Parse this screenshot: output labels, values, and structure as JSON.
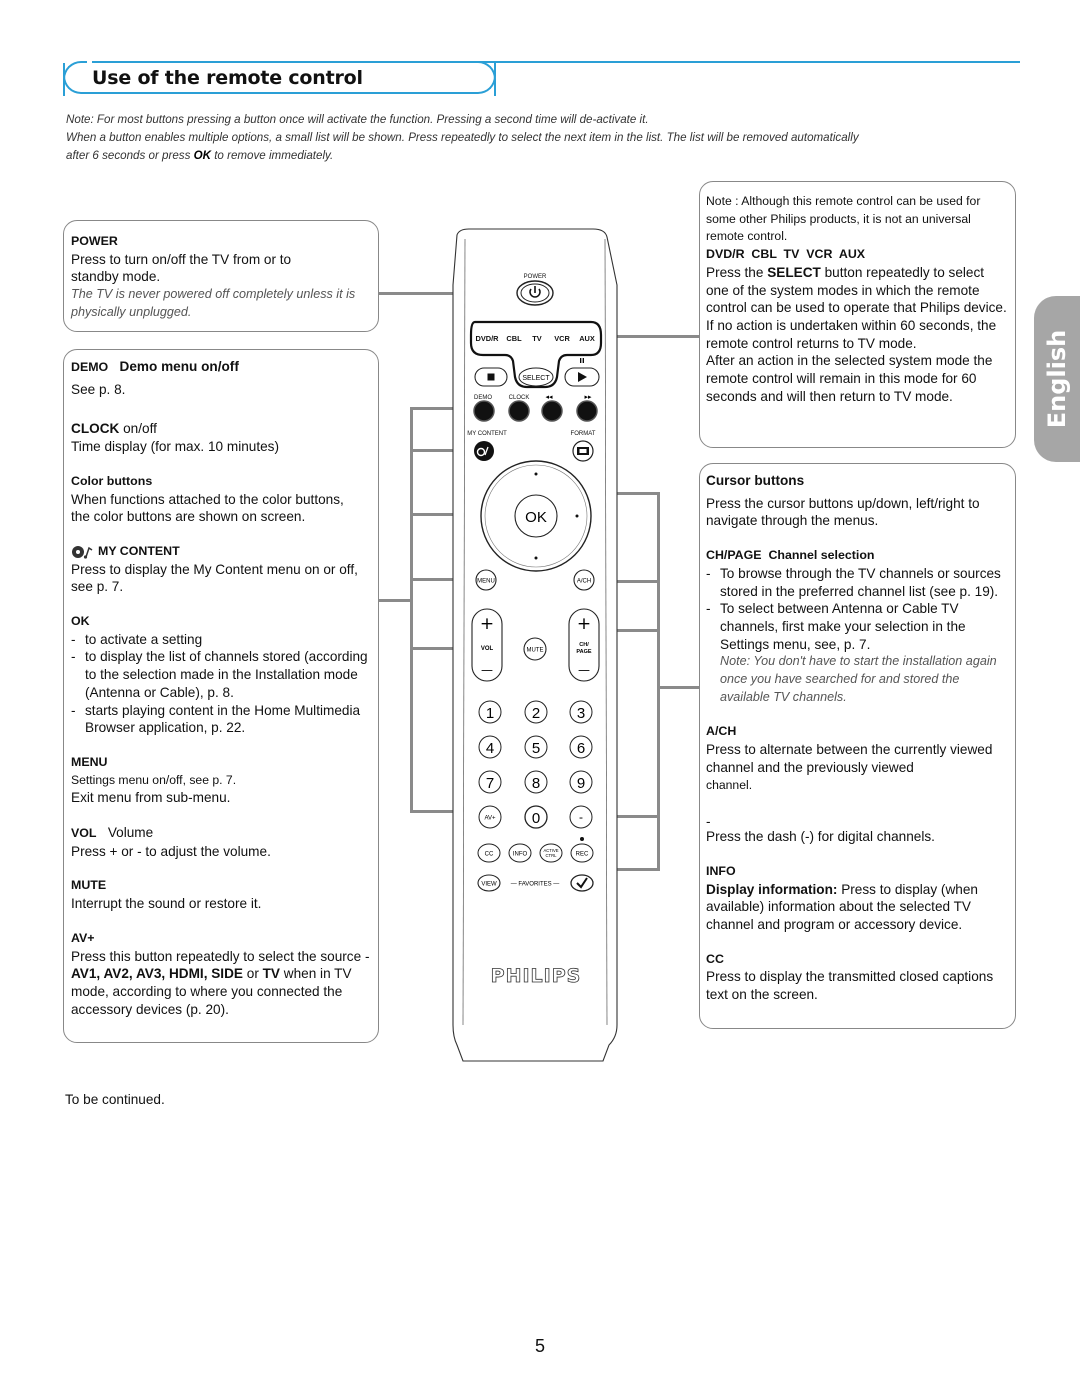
{
  "header": {
    "title": "Use of the remote control",
    "accent_color": "#2a9fd6"
  },
  "intro": {
    "line1": "Note: For most buttons pressing a button once will activate the function. Pressing a second time will de-activate it.",
    "line2": "When a button enables multiple options, a small list will be shown. Press repeatedly to select the next item in the list. The list will be removed automatically",
    "line3_before": "after 6 seconds or press ",
    "line3_bold": "OK",
    "line3_after": " to remove immediately."
  },
  "language_tab": {
    "label": "English",
    "color": "#a6a6a6"
  },
  "left": {
    "power": {
      "heading": "POWER",
      "text": "Press to turn on/off the TV from or to standby mode.",
      "note": "The TV is never powered off completely unless it is physically unplugged."
    },
    "demo": {
      "heading": "DEMO",
      "heading_desc": "Demo menu on/off",
      "text": "See p. 8."
    },
    "clock": {
      "heading": "CLOCK",
      "heading_desc": "on/off",
      "text": "Time display (for max. 10 minutes)"
    },
    "color_buttons": {
      "heading": "Color buttons",
      "text": "When functions attached to the color buttons, the color buttons are shown on screen."
    },
    "my_content": {
      "icon": "my-content-icon",
      "heading": "MY CONTENT",
      "text": "Press to display the My Content menu on or off, see p. 7."
    },
    "ok": {
      "heading": "OK",
      "items": [
        "to activate a setting",
        "to display the list of channels stored (according to the selection made in the Installation mode (Antenna or Cable), p. 8.",
        "starts playing content in the Home Multimedia Browser application, p.  22."
      ]
    },
    "menu": {
      "heading": "MENU",
      "line1": "Settings menu on/off, see p. 7.",
      "line2": "Exit menu from sub-menu."
    },
    "vol": {
      "heading": "VOL",
      "heading_desc": "Volume",
      "text": "Press + or - to adjust the volume."
    },
    "mute": {
      "heading": "MUTE",
      "text": "Interrupt the sound or restore it."
    },
    "avplus": {
      "heading": "AV+",
      "text_before": "Press this button repeatedly to select the source - ",
      "sources": "AV1, AV2, AV3, HDMI, SIDE",
      "or": " or ",
      "tv": "TV",
      "text_after": " when in TV mode, according to where you connected the accessory devices (p. 20)."
    }
  },
  "right": {
    "system": {
      "note": "Note : Although this remote control can be used for some other Philips products, it is not an universal remote control.",
      "heading": "DVD/R  CBL  TV  VCR  AUX",
      "p1_before": "Press the ",
      "p1_bold": "SELECT",
      "p1_after": " button repeatedly to select one of the system modes in which the remote control can be used to operate that Philips device.",
      "p2": "If no action is undertaken within 60 seconds, the remote control returns to TV mode.",
      "p3": "After an action in the selected system mode the remote control will remain in this mode for 60 seconds and will then return to TV mode."
    },
    "cursor": {
      "heading": "Cursor buttons",
      "text": "Press the cursor buttons up/down, left/right to navigate through the menus."
    },
    "chpage": {
      "heading": "CH/PAGE",
      "heading_desc": "Channel selection",
      "items": [
        "To browse through the TV channels or sources stored in the preferred channel list (see p. 19).",
        "To select between Antenna or Cable TV channels, first make your selection in the Settings menu, see, p. 7."
      ],
      "note": "Note: You don't have to start the installation again once you have searched for and stored the available TV channels."
    },
    "ach": {
      "heading": "A/CH",
      "text1": "Press to alternate between the currently viewed channel and the previously viewed",
      "text2": "channel."
    },
    "dash": {
      "heading": "-",
      "text": "Press the dash (-) for digital channels."
    },
    "info": {
      "heading": "INFO",
      "bold": "Display information:",
      "text": " Press to display (when available) information about the selected TV channel and program or accessory device."
    },
    "cc": {
      "heading": "CC",
      "text": "Press to display the transmitted closed captions text on the screen."
    }
  },
  "remote": {
    "power_label": "POWER",
    "modes": [
      "DVD/R",
      "CBL",
      "TV",
      "VCR",
      "AUX"
    ],
    "select": "SELECT",
    "demo": "DEMO",
    "clock": "CLOCK",
    "my_content": "MY CONTENT",
    "format": "FORMAT",
    "ok": "OK",
    "menu": "MENU",
    "ach": "A/CH",
    "vol": "VOL",
    "mute": "MUTE",
    "ch": "CH/",
    "page": "PAGE",
    "plus": "+",
    "minus": "—",
    "digits": [
      "1",
      "2",
      "3",
      "4",
      "5",
      "6",
      "7",
      "8",
      "9"
    ],
    "avplus": "AV+",
    "zero": "0",
    "dash": "-",
    "cc": "CC",
    "info": "INFO",
    "active": "ACTIVE",
    "ctrl": "CTRL",
    "rec": "REC",
    "view": "VIEW",
    "favorites": "— FAVORITES —",
    "brand": "PHILIPS"
  },
  "footer": {
    "continued": "To be continued.",
    "page_number": "5"
  }
}
